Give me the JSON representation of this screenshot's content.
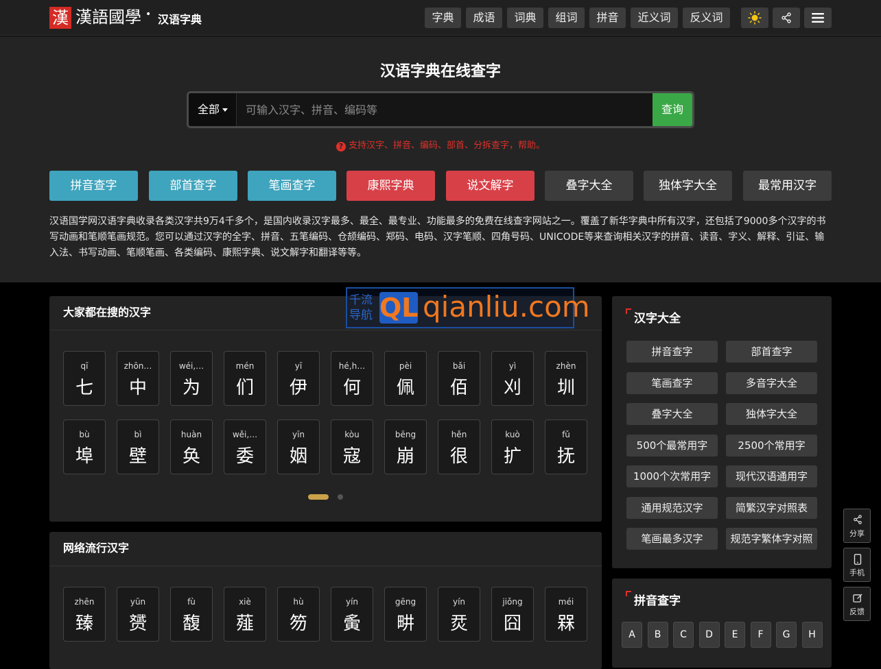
{
  "nav": {
    "logo_seal": "漢",
    "logo_text": "漢語國學",
    "site_name": "汉语字典",
    "links": [
      "字典",
      "成语",
      "词典",
      "组词",
      "拼音",
      "近义词",
      "反义词"
    ]
  },
  "hero": {
    "title": "汉语字典在线查字",
    "scope_label": "全部",
    "search_placeholder": "可输入汉字、拼音、编码等",
    "search_button": "查询",
    "hint": "支持汉字、拼音、编码、部首、分拆查字，帮助。",
    "quick_buttons": [
      {
        "label": "拼音查字",
        "color": "#3fa4bd"
      },
      {
        "label": "部首查字",
        "color": "#3fa4bd"
      },
      {
        "label": "笔画查字",
        "color": "#3fa4bd"
      },
      {
        "label": "康熙字典",
        "color": "#d84048"
      },
      {
        "label": "说文解字",
        "color": "#d84048"
      },
      {
        "label": "叠字大全",
        "color": "#3c3c3c"
      },
      {
        "label": "独体字大全",
        "color": "#3c3c3c"
      },
      {
        "label": "最常用汉字",
        "color": "#3c3c3c"
      }
    ],
    "intro": "汉语国学网汉语字典收录各类汉字共9万4千多个，是国内收录汉字最多、最全、最专业、功能最多的免费在线查字网站之一。覆盖了新华字典中所有汉字，还包括了9000多个汉字的书写动画和笔顺笔画规范。您可以通过汉字的全字、拼音、五笔编码、仓颉编码、郑码、电码、汉字笔顺、四角号码、UNICODE等来查询相关汉字的拼音、读音、字义、解释、引证、输入法、书写动画、笔顺笔画、各类编码、康熙字典、说文解字和翻译等等。"
  },
  "watermark": {
    "cn": "千流导航",
    "ql": "QL",
    "domain": "qianliu.com"
  },
  "popular": {
    "title": "大家都在搜的汉字",
    "chars": [
      {
        "py": "qī",
        "hz": "七"
      },
      {
        "py": "zhōn…",
        "hz": "中"
      },
      {
        "py": "wéi,…",
        "hz": "为"
      },
      {
        "py": "mén",
        "hz": "们"
      },
      {
        "py": "yī",
        "hz": "伊"
      },
      {
        "py": "hé,h…",
        "hz": "何"
      },
      {
        "py": "pèi",
        "hz": "佩"
      },
      {
        "py": "bǎi",
        "hz": "佰"
      },
      {
        "py": "yì",
        "hz": "刈"
      },
      {
        "py": "zhèn",
        "hz": "圳"
      },
      {
        "py": "bù",
        "hz": "埠"
      },
      {
        "py": "bì",
        "hz": "壁"
      },
      {
        "py": "huàn",
        "hz": "奂"
      },
      {
        "py": "wěi,…",
        "hz": "委"
      },
      {
        "py": "yīn",
        "hz": "姻"
      },
      {
        "py": "kòu",
        "hz": "寇"
      },
      {
        "py": "bēng",
        "hz": "崩"
      },
      {
        "py": "hěn",
        "hz": "很"
      },
      {
        "py": "kuò",
        "hz": "扩"
      },
      {
        "py": "fǔ",
        "hz": "抚"
      }
    ]
  },
  "trending": {
    "title": "网络流行汉字",
    "chars": [
      {
        "py": "zhēn",
        "hz": "臻"
      },
      {
        "py": "yūn",
        "hz": "赟"
      },
      {
        "py": "fù",
        "hz": "馥"
      },
      {
        "py": "xiè",
        "hz": "薤"
      },
      {
        "py": "hù",
        "hz": "笏"
      },
      {
        "py": "yín",
        "hz": "夤"
      },
      {
        "py": "gēng",
        "hz": "畊"
      },
      {
        "py": "yín",
        "hz": "烎"
      },
      {
        "py": "jiǒng",
        "hz": "囧"
      },
      {
        "py": "méi",
        "hz": "槑"
      }
    ]
  },
  "sidebar": {
    "title": "汉字大全",
    "links": [
      "拼音查字",
      "部首查字",
      "笔画查字",
      "多音字大全",
      "叠字大全",
      "独体字大全",
      "500个最常用字",
      "2500个常用字",
      "1000个次常用字",
      "现代汉语通用字",
      "通用规范汉字",
      "简繁汉字对照表",
      "笔画最多汉字",
      "规范字繁体字对照"
    ]
  },
  "pinyin": {
    "title": "拼音查字",
    "letters": [
      "A",
      "B",
      "C",
      "D",
      "E",
      "F",
      "G",
      "H"
    ]
  },
  "float": {
    "share": "分享",
    "mobile": "手机",
    "feedback": "反馈"
  }
}
